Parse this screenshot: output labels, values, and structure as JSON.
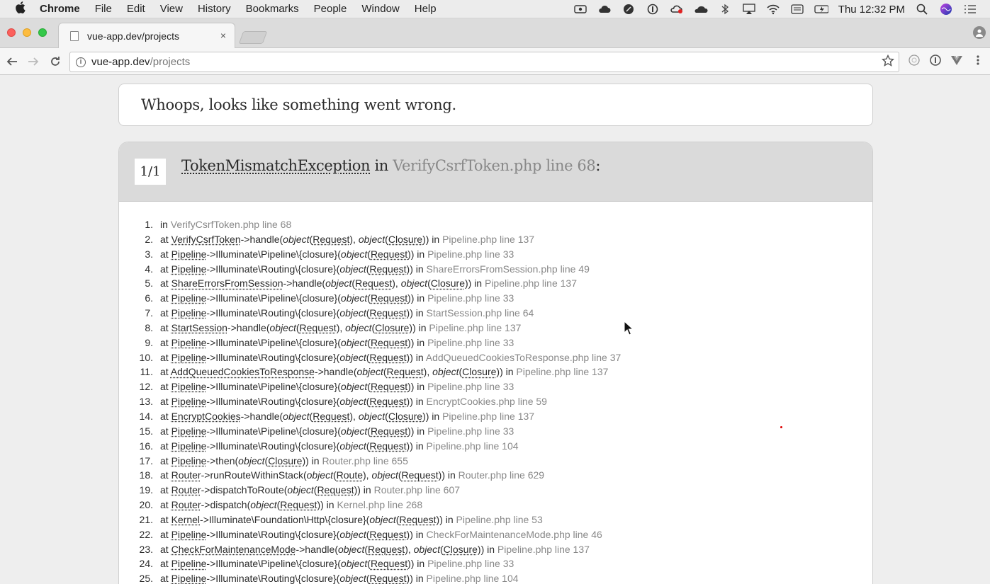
{
  "menubar": {
    "apple_icon": "apple-icon",
    "app_name": "Chrome",
    "items": [
      "File",
      "Edit",
      "View",
      "History",
      "Bookmarks",
      "People",
      "Window",
      "Help"
    ],
    "clock": "Thu 12:32 PM",
    "tray_icons": [
      "video-icon",
      "cloud-icon",
      "feather-icon",
      "onepassword-icon",
      "creative-cloud-icon",
      "cloud-dark-icon",
      "bluetooth-icon",
      "airplay-icon",
      "wifi-icon",
      "keyboard-icon",
      "battery-icon"
    ]
  },
  "browser": {
    "tab": {
      "title": "vue-app.dev/projects",
      "close": "×"
    },
    "omnibox": {
      "host": "vue-app.dev",
      "path": "/projects"
    }
  },
  "page": {
    "whoops": "Whoops, looks like something went wrong.",
    "counter": "1/1",
    "exception": {
      "class": "TokenMismatchException",
      "in_word": " in ",
      "file": "VerifyCsrfToken.php line 68",
      "colon": ":"
    },
    "trace": [
      {
        "n": "1.",
        "parts": [
          [
            "t",
            "in "
          ],
          [
            "loc",
            "VerifyCsrfToken.php line 68"
          ]
        ]
      },
      {
        "n": "2.",
        "parts": [
          [
            "t",
            "at "
          ],
          [
            "cls",
            "VerifyCsrfToken"
          ],
          [
            "t",
            "->handle("
          ],
          [
            "obj",
            "object"
          ],
          [
            "t",
            "("
          ],
          [
            "arg",
            "Request"
          ],
          [
            "t",
            "), "
          ],
          [
            "obj",
            "object"
          ],
          [
            "t",
            "("
          ],
          [
            "arg",
            "Closure"
          ],
          [
            "t",
            ")) in "
          ],
          [
            "loc",
            "Pipeline.php line 137"
          ]
        ]
      },
      {
        "n": "3.",
        "parts": [
          [
            "t",
            "at "
          ],
          [
            "cls",
            "Pipeline"
          ],
          [
            "t",
            "->Illuminate\\Pipeline\\{closure}("
          ],
          [
            "obj",
            "object"
          ],
          [
            "t",
            "("
          ],
          [
            "arg",
            "Request"
          ],
          [
            "t",
            ")) in "
          ],
          [
            "loc",
            "Pipeline.php line 33"
          ]
        ]
      },
      {
        "n": "4.",
        "parts": [
          [
            "t",
            "at "
          ],
          [
            "cls",
            "Pipeline"
          ],
          [
            "t",
            "->Illuminate\\Routing\\{closure}("
          ],
          [
            "obj",
            "object"
          ],
          [
            "t",
            "("
          ],
          [
            "arg",
            "Request"
          ],
          [
            "t",
            ")) in "
          ],
          [
            "loc",
            "ShareErrorsFromSession.php line 49"
          ]
        ]
      },
      {
        "n": "5.",
        "parts": [
          [
            "t",
            "at "
          ],
          [
            "cls",
            "ShareErrorsFromSession"
          ],
          [
            "t",
            "->handle("
          ],
          [
            "obj",
            "object"
          ],
          [
            "t",
            "("
          ],
          [
            "arg",
            "Request"
          ],
          [
            "t",
            "), "
          ],
          [
            "obj",
            "object"
          ],
          [
            "t",
            "("
          ],
          [
            "arg",
            "Closure"
          ],
          [
            "t",
            ")) in "
          ],
          [
            "loc",
            "Pipeline.php line 137"
          ]
        ]
      },
      {
        "n": "6.",
        "parts": [
          [
            "t",
            "at "
          ],
          [
            "cls",
            "Pipeline"
          ],
          [
            "t",
            "->Illuminate\\Pipeline\\{closure}("
          ],
          [
            "obj",
            "object"
          ],
          [
            "t",
            "("
          ],
          [
            "arg",
            "Request"
          ],
          [
            "t",
            ")) in "
          ],
          [
            "loc",
            "Pipeline.php line 33"
          ]
        ]
      },
      {
        "n": "7.",
        "parts": [
          [
            "t",
            "at "
          ],
          [
            "cls",
            "Pipeline"
          ],
          [
            "t",
            "->Illuminate\\Routing\\{closure}("
          ],
          [
            "obj",
            "object"
          ],
          [
            "t",
            "("
          ],
          [
            "arg",
            "Request"
          ],
          [
            "t",
            ")) in "
          ],
          [
            "loc",
            "StartSession.php line 64"
          ]
        ]
      },
      {
        "n": "8.",
        "parts": [
          [
            "t",
            "at "
          ],
          [
            "cls",
            "StartSession"
          ],
          [
            "t",
            "->handle("
          ],
          [
            "obj",
            "object"
          ],
          [
            "t",
            "("
          ],
          [
            "arg",
            "Request"
          ],
          [
            "t",
            "), "
          ],
          [
            "obj",
            "object"
          ],
          [
            "t",
            "("
          ],
          [
            "arg",
            "Closure"
          ],
          [
            "t",
            ")) in "
          ],
          [
            "loc",
            "Pipeline.php line 137"
          ]
        ]
      },
      {
        "n": "9.",
        "parts": [
          [
            "t",
            "at "
          ],
          [
            "cls",
            "Pipeline"
          ],
          [
            "t",
            "->Illuminate\\Pipeline\\{closure}("
          ],
          [
            "obj",
            "object"
          ],
          [
            "t",
            "("
          ],
          [
            "arg",
            "Request"
          ],
          [
            "t",
            ")) in "
          ],
          [
            "loc",
            "Pipeline.php line 33"
          ]
        ]
      },
      {
        "n": "10.",
        "parts": [
          [
            "t",
            "at "
          ],
          [
            "cls",
            "Pipeline"
          ],
          [
            "t",
            "->Illuminate\\Routing\\{closure}("
          ],
          [
            "obj",
            "object"
          ],
          [
            "t",
            "("
          ],
          [
            "arg",
            "Request"
          ],
          [
            "t",
            ")) in "
          ],
          [
            "loc",
            "AddQueuedCookiesToResponse.php line 37"
          ]
        ]
      },
      {
        "n": "11.",
        "parts": [
          [
            "t",
            "at "
          ],
          [
            "cls",
            "AddQueuedCookiesToResponse"
          ],
          [
            "t",
            "->handle("
          ],
          [
            "obj",
            "object"
          ],
          [
            "t",
            "("
          ],
          [
            "arg",
            "Request"
          ],
          [
            "t",
            "), "
          ],
          [
            "obj",
            "object"
          ],
          [
            "t",
            "("
          ],
          [
            "arg",
            "Closure"
          ],
          [
            "t",
            ")) in "
          ],
          [
            "loc",
            "Pipeline.php line 137"
          ]
        ]
      },
      {
        "n": "12.",
        "parts": [
          [
            "t",
            "at "
          ],
          [
            "cls",
            "Pipeline"
          ],
          [
            "t",
            "->Illuminate\\Pipeline\\{closure}("
          ],
          [
            "obj",
            "object"
          ],
          [
            "t",
            "("
          ],
          [
            "arg",
            "Request"
          ],
          [
            "t",
            ")) in "
          ],
          [
            "loc",
            "Pipeline.php line 33"
          ]
        ]
      },
      {
        "n": "13.",
        "parts": [
          [
            "t",
            "at "
          ],
          [
            "cls",
            "Pipeline"
          ],
          [
            "t",
            "->Illuminate\\Routing\\{closure}("
          ],
          [
            "obj",
            "object"
          ],
          [
            "t",
            "("
          ],
          [
            "arg",
            "Request"
          ],
          [
            "t",
            ")) in "
          ],
          [
            "loc",
            "EncryptCookies.php line 59"
          ]
        ]
      },
      {
        "n": "14.",
        "parts": [
          [
            "t",
            "at "
          ],
          [
            "cls",
            "EncryptCookies"
          ],
          [
            "t",
            "->handle("
          ],
          [
            "obj",
            "object"
          ],
          [
            "t",
            "("
          ],
          [
            "arg",
            "Request"
          ],
          [
            "t",
            "), "
          ],
          [
            "obj",
            "object"
          ],
          [
            "t",
            "("
          ],
          [
            "arg",
            "Closure"
          ],
          [
            "t",
            ")) in "
          ],
          [
            "loc",
            "Pipeline.php line 137"
          ]
        ]
      },
      {
        "n": "15.",
        "parts": [
          [
            "t",
            "at "
          ],
          [
            "cls",
            "Pipeline"
          ],
          [
            "t",
            "->Illuminate\\Pipeline\\{closure}("
          ],
          [
            "obj",
            "object"
          ],
          [
            "t",
            "("
          ],
          [
            "arg",
            "Request"
          ],
          [
            "t",
            ")) in "
          ],
          [
            "loc",
            "Pipeline.php line 33"
          ]
        ]
      },
      {
        "n": "16.",
        "parts": [
          [
            "t",
            "at "
          ],
          [
            "cls",
            "Pipeline"
          ],
          [
            "t",
            "->Illuminate\\Routing\\{closure}("
          ],
          [
            "obj",
            "object"
          ],
          [
            "t",
            "("
          ],
          [
            "arg",
            "Request"
          ],
          [
            "t",
            ")) in "
          ],
          [
            "loc",
            "Pipeline.php line 104"
          ]
        ]
      },
      {
        "n": "17.",
        "parts": [
          [
            "t",
            "at "
          ],
          [
            "cls",
            "Pipeline"
          ],
          [
            "t",
            "->then("
          ],
          [
            "obj",
            "object"
          ],
          [
            "t",
            "("
          ],
          [
            "arg",
            "Closure"
          ],
          [
            "t",
            ")) in "
          ],
          [
            "loc",
            "Router.php line 655"
          ]
        ]
      },
      {
        "n": "18.",
        "parts": [
          [
            "t",
            "at "
          ],
          [
            "cls",
            "Router"
          ],
          [
            "t",
            "->runRouteWithinStack("
          ],
          [
            "obj",
            "object"
          ],
          [
            "t",
            "("
          ],
          [
            "arg",
            "Route"
          ],
          [
            "t",
            "), "
          ],
          [
            "obj",
            "object"
          ],
          [
            "t",
            "("
          ],
          [
            "arg",
            "Request"
          ],
          [
            "t",
            ")) in "
          ],
          [
            "loc",
            "Router.php line 629"
          ]
        ]
      },
      {
        "n": "19.",
        "parts": [
          [
            "t",
            "at "
          ],
          [
            "cls",
            "Router"
          ],
          [
            "t",
            "->dispatchToRoute("
          ],
          [
            "obj",
            "object"
          ],
          [
            "t",
            "("
          ],
          [
            "arg",
            "Request"
          ],
          [
            "t",
            ")) in "
          ],
          [
            "loc",
            "Router.php line 607"
          ]
        ]
      },
      {
        "n": "20.",
        "parts": [
          [
            "t",
            "at "
          ],
          [
            "cls",
            "Router"
          ],
          [
            "t",
            "->dispatch("
          ],
          [
            "obj",
            "object"
          ],
          [
            "t",
            "("
          ],
          [
            "arg",
            "Request"
          ],
          [
            "t",
            ")) in "
          ],
          [
            "loc",
            "Kernel.php line 268"
          ]
        ]
      },
      {
        "n": "21.",
        "parts": [
          [
            "t",
            "at "
          ],
          [
            "cls",
            "Kernel"
          ],
          [
            "t",
            "->Illuminate\\Foundation\\Http\\{closure}("
          ],
          [
            "obj",
            "object"
          ],
          [
            "t",
            "("
          ],
          [
            "arg",
            "Request"
          ],
          [
            "t",
            ")) in "
          ],
          [
            "loc",
            "Pipeline.php line 53"
          ]
        ]
      },
      {
        "n": "22.",
        "parts": [
          [
            "t",
            "at "
          ],
          [
            "cls",
            "Pipeline"
          ],
          [
            "t",
            "->Illuminate\\Routing\\{closure}("
          ],
          [
            "obj",
            "object"
          ],
          [
            "t",
            "("
          ],
          [
            "arg",
            "Request"
          ],
          [
            "t",
            ")) in "
          ],
          [
            "loc",
            "CheckForMaintenanceMode.php line 46"
          ]
        ]
      },
      {
        "n": "23.",
        "parts": [
          [
            "t",
            "at "
          ],
          [
            "cls",
            "CheckForMaintenanceMode"
          ],
          [
            "t",
            "->handle("
          ],
          [
            "obj",
            "object"
          ],
          [
            "t",
            "("
          ],
          [
            "arg",
            "Request"
          ],
          [
            "t",
            "), "
          ],
          [
            "obj",
            "object"
          ],
          [
            "t",
            "("
          ],
          [
            "arg",
            "Closure"
          ],
          [
            "t",
            ")) in "
          ],
          [
            "loc",
            "Pipeline.php line 137"
          ]
        ]
      },
      {
        "n": "24.",
        "parts": [
          [
            "t",
            "at "
          ],
          [
            "cls",
            "Pipeline"
          ],
          [
            "t",
            "->Illuminate\\Pipeline\\{closure}("
          ],
          [
            "obj",
            "object"
          ],
          [
            "t",
            "("
          ],
          [
            "arg",
            "Request"
          ],
          [
            "t",
            ")) in "
          ],
          [
            "loc",
            "Pipeline.php line 33"
          ]
        ]
      },
      {
        "n": "25.",
        "parts": [
          [
            "t",
            "at "
          ],
          [
            "cls",
            "Pipeline"
          ],
          [
            "t",
            "->Illuminate\\Routing\\{closure}("
          ],
          [
            "obj",
            "object"
          ],
          [
            "t",
            "("
          ],
          [
            "arg",
            "Request"
          ],
          [
            "t",
            ")) in "
          ],
          [
            "loc",
            "Pipeline.php line 104"
          ]
        ]
      }
    ]
  }
}
